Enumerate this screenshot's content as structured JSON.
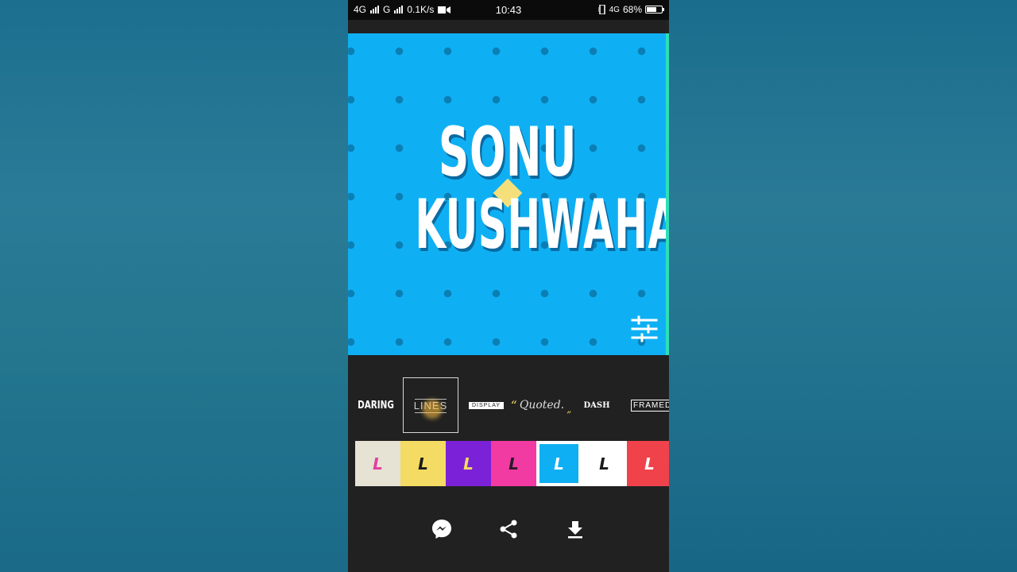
{
  "status_bar": {
    "network1": "4G",
    "network2": "G",
    "speed": "0.1K/s",
    "time": "10:43",
    "network3": "4G",
    "battery": "68%",
    "battery_level": 0.68
  },
  "canvas": {
    "line1": "SONU",
    "line2": "KUSHWAHA",
    "background_color": "#0fb0f3",
    "dot_color": "#0b7fb5",
    "accent_color": "#f4df7a"
  },
  "text_styles": [
    {
      "label": "DARING",
      "selected": false
    },
    {
      "label": "LINES",
      "selected": true
    },
    {
      "label": "DISPLAY",
      "selected": false
    },
    {
      "label": "Quoted.",
      "selected": false
    },
    {
      "label": "DASH",
      "selected": false
    },
    {
      "label": "FRAMED",
      "selected": false
    }
  ],
  "quote_open": "“",
  "quote_close": "„",
  "color_swatches": [
    {
      "letter": "L",
      "bg": "#e6e2d4",
      "fg": "#e23fa0",
      "selected": false
    },
    {
      "letter": "L",
      "bg": "#f4db63",
      "fg": "#1a1a1a",
      "selected": false
    },
    {
      "letter": "L",
      "bg": "#7b22d8",
      "fg": "#f4db63",
      "selected": false
    },
    {
      "letter": "L",
      "bg": "#f23aa3",
      "fg": "#2a1a2a",
      "selected": false
    },
    {
      "letter": "L",
      "bg": "#0fb0f3",
      "fg": "#ffffff",
      "selected": true
    },
    {
      "letter": "L",
      "bg": "#ffffff",
      "fg": "#1a1a1a",
      "selected": false
    },
    {
      "letter": "L",
      "bg": "#f0424a",
      "fg": "#ffffff",
      "selected": false
    }
  ],
  "actions": {
    "messenger": "messenger-icon",
    "share": "share-icon",
    "download": "download-icon"
  }
}
